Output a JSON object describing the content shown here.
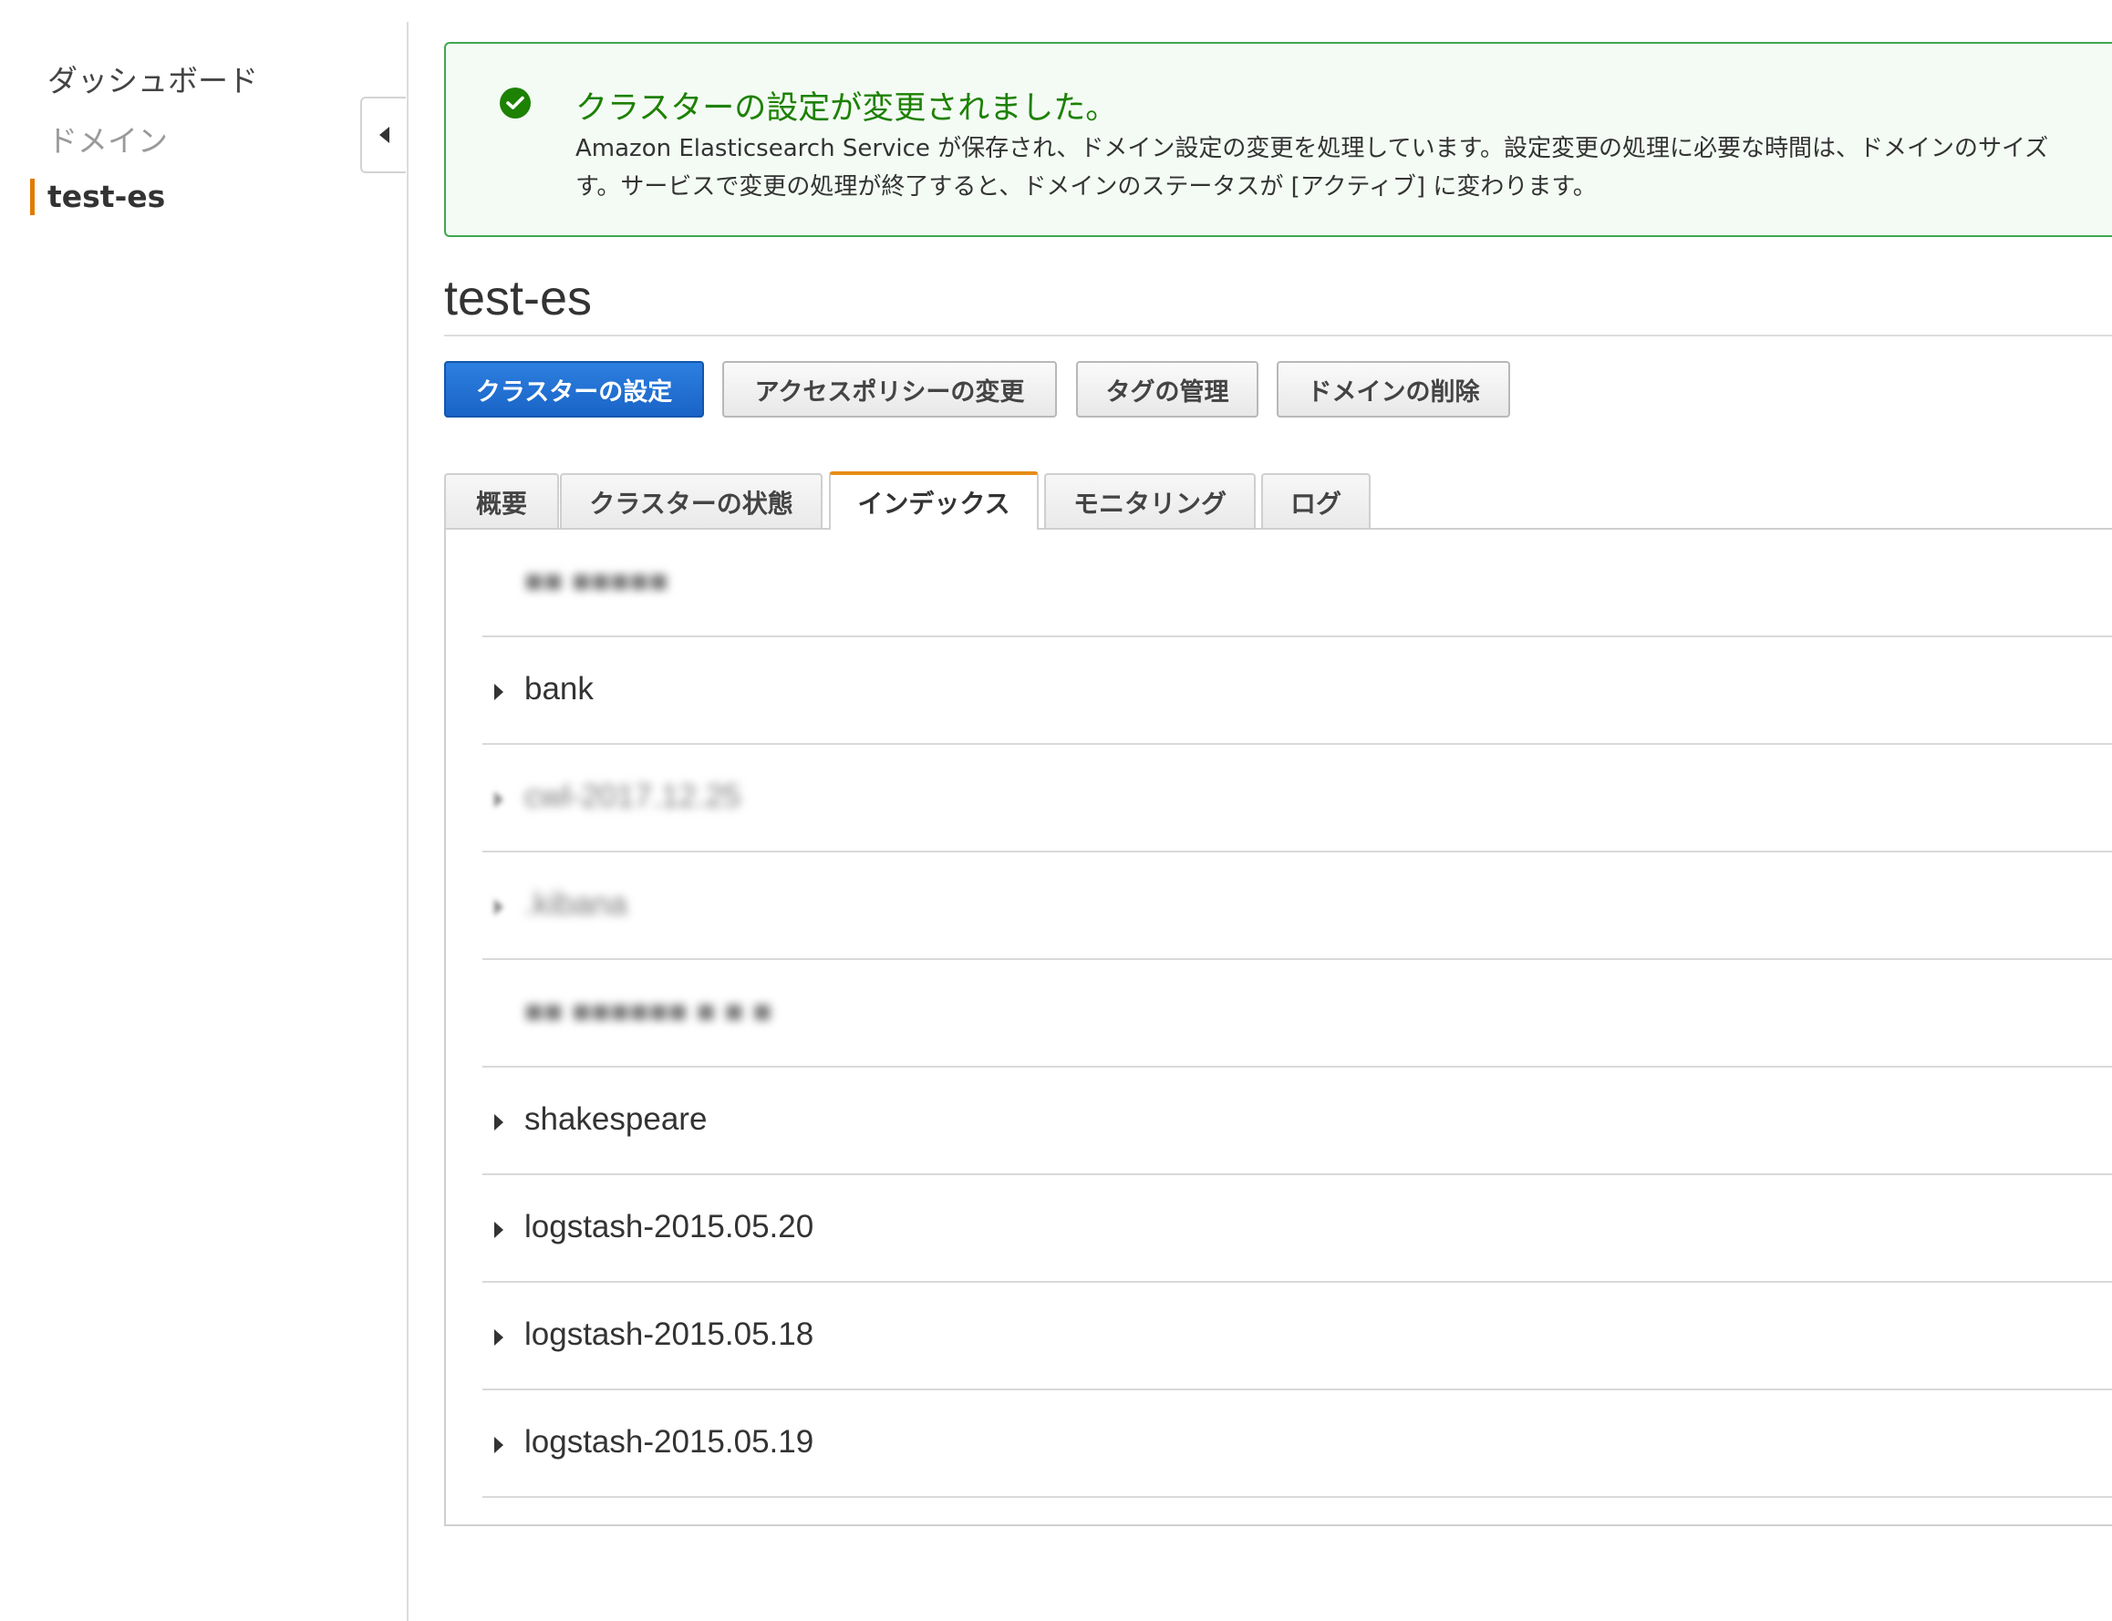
{
  "sidebar": {
    "items": [
      {
        "label": "ダッシュボード"
      },
      {
        "label": "ドメイン"
      },
      {
        "label": "test-es"
      }
    ]
  },
  "flash": {
    "title": "クラスターの設定が変更されました。",
    "line1": "Amazon Elasticsearch Service が保存され、ドメイン設定の変更を処理しています。設定変更の処理に必要な時間は、ドメインのサイズ",
    "line2": "す。サービスで変更の処理が終了すると、ドメインのステータスが [アクティブ] に変わります。"
  },
  "page": {
    "title": "test-es"
  },
  "actions": {
    "configure_cluster": "クラスターの設定",
    "modify_access_policy": "アクセスポリシーの変更",
    "manage_tags": "タグの管理",
    "delete_domain": "ドメインの削除"
  },
  "tabs": [
    {
      "label": "概要"
    },
    {
      "label": "クラスターの状態"
    },
    {
      "label": "インデックス"
    },
    {
      "label": "モニタリング"
    },
    {
      "label": "ログ"
    }
  ],
  "indices": [
    {
      "name": "■■ ■■■■■",
      "blurred": true
    },
    {
      "name": "bank",
      "blurred": false
    },
    {
      "name": "cwl-2017.12.25",
      "blurred": true
    },
    {
      "name": ".kibana",
      "blurred": true
    },
    {
      "name": "■■ ■■■■■■ ■ ■ ■",
      "blurred": true
    },
    {
      "name": "shakespeare",
      "blurred": false
    },
    {
      "name": "logstash-2015.05.20",
      "blurred": false
    },
    {
      "name": "logstash-2015.05.18",
      "blurred": false
    },
    {
      "name": "logstash-2015.05.19",
      "blurred": false
    }
  ]
}
